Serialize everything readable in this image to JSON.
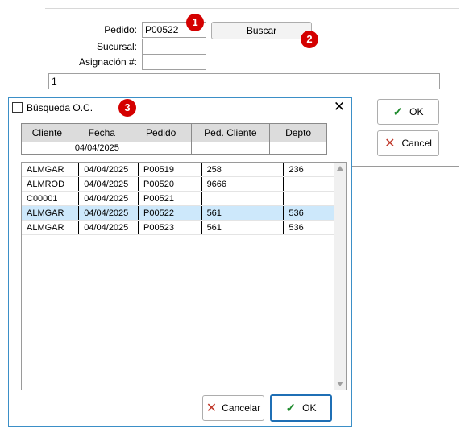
{
  "form": {
    "pedido_label": "Pedido:",
    "pedido_value": "P00522",
    "sucursal_label": "Sucursal:",
    "sucursal_value": "",
    "asignacion_label": "Asignación #:",
    "asignacion_value": "",
    "text_value": "1",
    "buscar_label": "Buscar",
    "ok_label": "OK",
    "cancel_label": "Cancel"
  },
  "badges": [
    "1",
    "2",
    "3"
  ],
  "dialog": {
    "title": "Búsqueda O.C.",
    "columns": [
      "Cliente",
      "Fecha",
      "Pedido",
      "Ped. Cliente",
      "Depto"
    ],
    "filters": [
      "",
      "04/04/2025",
      "",
      "",
      ""
    ],
    "rows": [
      [
        "ALMGAR",
        "04/04/2025",
        "P00519",
        "258",
        "236"
      ],
      [
        "ALMROD",
        "04/04/2025",
        "P00520",
        "9666",
        ""
      ],
      [
        "C00001",
        "04/04/2025",
        "P00521",
        "",
        ""
      ],
      [
        "ALMGAR",
        "04/04/2025",
        "P00522",
        "561",
        "536"
      ],
      [
        "ALMGAR",
        "04/04/2025",
        "P00523",
        "561",
        "536"
      ]
    ],
    "selected_row": 3,
    "cancel_label": "Cancelar",
    "ok_label": "OK"
  },
  "colors": {
    "badge": "#d40000",
    "selection": "#cde8fb",
    "dialog_border": "#3b8fc7",
    "check": "#1d8a2c"
  },
  "icons": [
    "check-icon",
    "x-icon",
    "close-icon",
    "window-icon"
  ]
}
